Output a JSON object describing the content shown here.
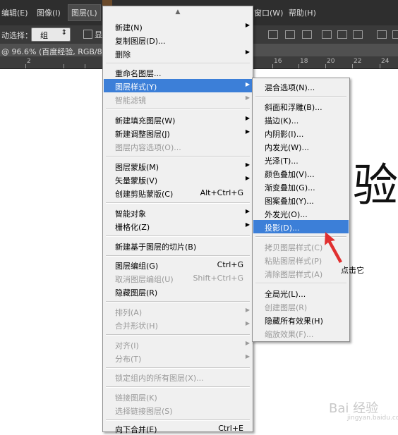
{
  "menubar": {
    "items": [
      {
        "label": "编辑(E)"
      },
      {
        "label": "图像(I)"
      },
      {
        "label": "图层(L)"
      },
      {
        "label": "窗口(W)"
      },
      {
        "label": "帮助(H)"
      }
    ]
  },
  "options_bar": {
    "auto_select_label": "动选择：",
    "auto_select_value": "组",
    "show_label": "显"
  },
  "document_tab": {
    "title": "@ 96.6% (百度经验, RGB/8)"
  },
  "ruler": {
    "numbers": [
      "2",
      "16",
      "18",
      "20",
      "22",
      "24"
    ]
  },
  "layer_menu": {
    "scroll_indicator": "▲",
    "items": [
      {
        "label": "新建(N)",
        "shortcut": "",
        "submenu": true,
        "disabled": false
      },
      {
        "label": "复制图层(D)...",
        "shortcut": "",
        "submenu": false,
        "disabled": false
      },
      {
        "label": "删除",
        "shortcut": "",
        "submenu": true,
        "disabled": false
      },
      {
        "label": "重命名图层...",
        "shortcut": "",
        "submenu": false,
        "disabled": false
      },
      {
        "label": "图层样式(Y)",
        "shortcut": "",
        "submenu": true,
        "disabled": false,
        "highlighted": true
      },
      {
        "label": "智能滤镜",
        "shortcut": "",
        "submenu": true,
        "disabled": true
      },
      {
        "label": "新建填充图层(W)",
        "shortcut": "",
        "submenu": true,
        "disabled": false
      },
      {
        "label": "新建调整图层(J)",
        "shortcut": "",
        "submenu": true,
        "disabled": false
      },
      {
        "label": "图层内容选项(O)...",
        "shortcut": "",
        "submenu": false,
        "disabled": true
      },
      {
        "label": "图层蒙版(M)",
        "shortcut": "",
        "submenu": true,
        "disabled": false
      },
      {
        "label": "矢量蒙版(V)",
        "shortcut": "",
        "submenu": true,
        "disabled": false
      },
      {
        "label": "创建剪贴蒙版(C)",
        "shortcut": "Alt+Ctrl+G",
        "submenu": false,
        "disabled": false
      },
      {
        "label": "智能对象",
        "shortcut": "",
        "submenu": true,
        "disabled": false
      },
      {
        "label": "栅格化(Z)",
        "shortcut": "",
        "submenu": true,
        "disabled": false
      },
      {
        "label": "新建基于图层的切片(B)",
        "shortcut": "",
        "submenu": false,
        "disabled": false
      },
      {
        "label": "图层编组(G)",
        "shortcut": "Ctrl+G",
        "submenu": false,
        "disabled": false
      },
      {
        "label": "取消图层编组(U)",
        "shortcut": "Shift+Ctrl+G",
        "submenu": false,
        "disabled": true
      },
      {
        "label": "隐藏图层(R)",
        "shortcut": "",
        "submenu": false,
        "disabled": false
      },
      {
        "label": "排列(A)",
        "shortcut": "",
        "submenu": true,
        "disabled": true
      },
      {
        "label": "合并形状(H)",
        "shortcut": "",
        "submenu": true,
        "disabled": true
      },
      {
        "label": "对齐(I)",
        "shortcut": "",
        "submenu": true,
        "disabled": true
      },
      {
        "label": "分布(T)",
        "shortcut": "",
        "submenu": true,
        "disabled": true
      },
      {
        "label": "锁定组内的所有图层(X)...",
        "shortcut": "",
        "submenu": false,
        "disabled": true
      },
      {
        "label": "链接图层(K)",
        "shortcut": "",
        "submenu": false,
        "disabled": true
      },
      {
        "label": "选择链接图层(S)",
        "shortcut": "",
        "submenu": false,
        "disabled": true
      },
      {
        "label": "向下合并(E)",
        "shortcut": "Ctrl+E",
        "submenu": false,
        "disabled": false
      }
    ]
  },
  "style_submenu": {
    "items": [
      {
        "label": "混合选项(N)...",
        "disabled": false
      },
      {
        "label": "斜面和浮雕(B)...",
        "disabled": false
      },
      {
        "label": "描边(K)...",
        "disabled": false
      },
      {
        "label": "内阴影(I)...",
        "disabled": false
      },
      {
        "label": "内发光(W)...",
        "disabled": false
      },
      {
        "label": "光泽(T)...",
        "disabled": false
      },
      {
        "label": "颜色叠加(V)...",
        "disabled": false
      },
      {
        "label": "渐变叠加(G)...",
        "disabled": false
      },
      {
        "label": "图案叠加(Y)...",
        "disabled": false
      },
      {
        "label": "外发光(O)...",
        "disabled": false
      },
      {
        "label": "投影(D)...",
        "disabled": false,
        "highlighted": true
      },
      {
        "label": "拷贝图层样式(C)",
        "disabled": true
      },
      {
        "label": "粘贴图层样式(P)",
        "disabled": true
      },
      {
        "label": "清除图层样式(A)",
        "disabled": true
      },
      {
        "label": "全局光(L)...",
        "disabled": false
      },
      {
        "label": "创建图层(R)",
        "disabled": true
      },
      {
        "label": "隐藏所有效果(H)",
        "disabled": false
      },
      {
        "label": "缩放效果(F)...",
        "disabled": true
      }
    ]
  },
  "canvas": {
    "big_char": "验"
  },
  "annotation": {
    "text": "点击它"
  },
  "watermark": {
    "main": "Bai 经验",
    "sub": "jingyan.baidu.com"
  },
  "colors": {
    "highlight": "#3c7fd8",
    "arrow": "#e03030",
    "menu_bg": "#f0f0f0",
    "disabled_text": "#9a9a9a"
  }
}
